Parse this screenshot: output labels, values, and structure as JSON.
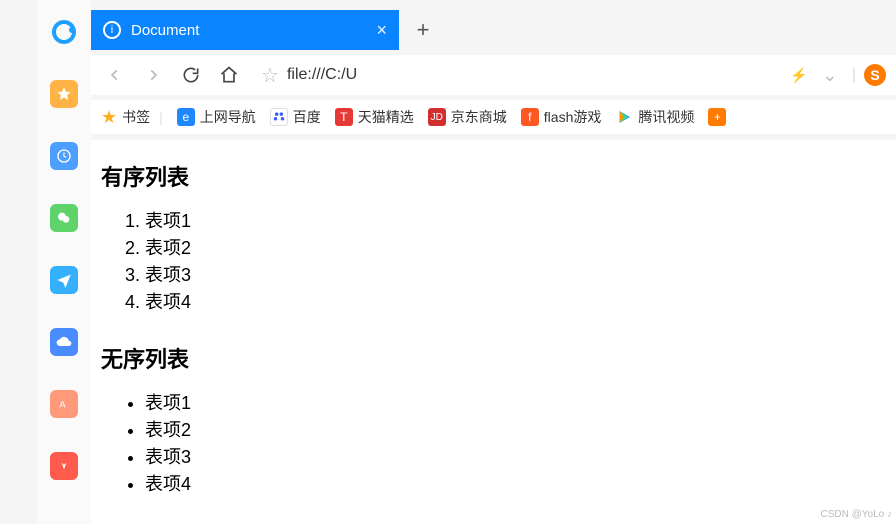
{
  "tab": {
    "title": "Document",
    "info_icon": "i"
  },
  "url": "file:///C:/U",
  "bookmarks": {
    "items": [
      {
        "label": "书签"
      },
      {
        "label": "上网导航"
      },
      {
        "label": "百度"
      },
      {
        "label": "天猫精选"
      },
      {
        "label": "京东商城"
      },
      {
        "label": "flash游戏"
      },
      {
        "label": "腾讯视频"
      }
    ]
  },
  "page": {
    "heading1": "有序列表",
    "ordered": [
      "表项1",
      "表项2",
      "表项3",
      "表项4"
    ],
    "heading2": "无序列表",
    "unordered": [
      "表项1",
      "表项2",
      "表项3",
      "表项4"
    ]
  },
  "watermark": "CSDN @YoLo ♪"
}
